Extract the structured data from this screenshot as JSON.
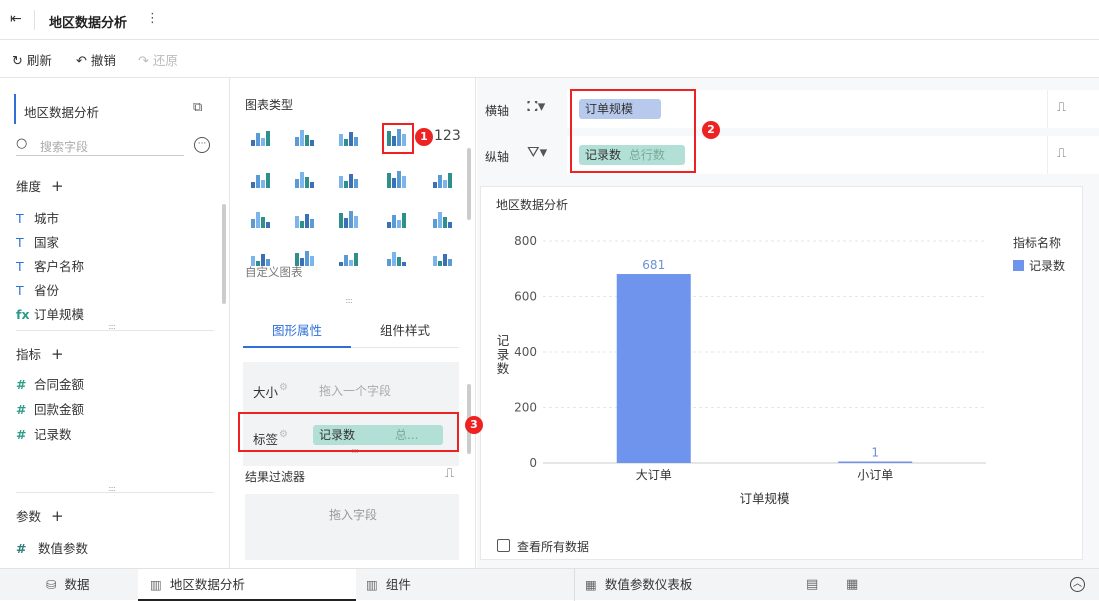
{
  "topbar": {
    "title": "地区数据分析"
  },
  "toolbar": {
    "refresh": "刷新",
    "undo": "撤销",
    "redo": "还原"
  },
  "left": {
    "dataset": "地区数据分析",
    "search_placeholder": "搜索字段",
    "dimension_title": "维度",
    "dimensions": [
      {
        "icon": "T",
        "label": "城市"
      },
      {
        "icon": "T",
        "label": "国家"
      },
      {
        "icon": "T",
        "label": "客户名称"
      },
      {
        "icon": "T",
        "label": "省份"
      },
      {
        "icon": "fx",
        "label": "订单规模"
      }
    ],
    "measure_title": "指标",
    "measures": [
      {
        "icon": "#",
        "label": "合同金额"
      },
      {
        "icon": "#",
        "label": "回款金额"
      },
      {
        "icon": "#",
        "label": "记录数"
      }
    ],
    "param_title": "参数",
    "params": [
      {
        "icon": "#",
        "label": "数值参数"
      }
    ]
  },
  "middle": {
    "chart_type_title": "图表类型",
    "custom_chart": "自定义图表",
    "tabs": [
      "图形属性",
      "组件样式"
    ],
    "size_label": "大小",
    "size_placeholder": "拖入一个字段",
    "label_label": "标签",
    "label_pill": "记录数",
    "label_pill_suffix": "总...",
    "filter_title": "结果过滤器",
    "filter_placeholder": "拖入字段"
  },
  "axes": {
    "x_label": "横轴",
    "x_field": "订单规模",
    "y_label": "纵轴",
    "y_field": "记录数",
    "y_field_suffix": "总行数"
  },
  "badges": [
    "1",
    "2",
    "3"
  ],
  "chart_data": {
    "type": "bar",
    "title": "地区数据分析",
    "categories": [
      "大订单",
      "小订单"
    ],
    "series": [
      {
        "name": "记录数",
        "values": [
          681,
          1
        ]
      }
    ],
    "data_labels": [
      "681",
      "1"
    ],
    "xlabel": "订单规模",
    "ylabel": "记录数",
    "ylim": [
      0,
      800
    ],
    "yticks": [
      "0",
      "200",
      "400",
      "600",
      "800"
    ],
    "legend_title": "指标名称",
    "legend_position": "top-right",
    "bar_color": "#6f94ee",
    "grid": true
  },
  "chart_footer": {
    "view_all": "查看所有数据"
  },
  "bottom_tabs": [
    "数据",
    "地区数据分析",
    "组件",
    "数值参数仪表板"
  ],
  "colors": {
    "accent": "#2f6fd8",
    "pill_blue": "#b7c9ec",
    "pill_green": "#b3e0d6",
    "highlight": "#e22222"
  }
}
